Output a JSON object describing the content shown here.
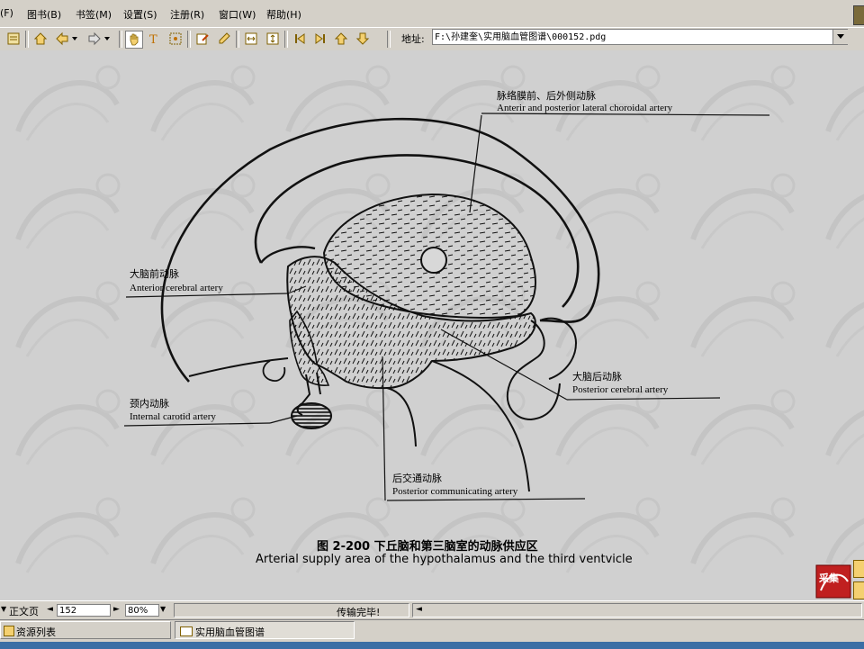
{
  "menu": {
    "items": [
      "(F)",
      "图书(B)",
      "书签(M)",
      "设置(S)",
      "注册(R)",
      "窗口(W)",
      "帮助(H)"
    ]
  },
  "toolbar": {
    "address_label": "地址:",
    "address_value": "F:\\孙建奎\\实用脑血管图谱\\000152.pdg"
  },
  "figure": {
    "labels": {
      "choroidal_cn": "脉络膜前、后外侧动脉",
      "choroidal_en": "Anterir and posterior lateral choroidal artery",
      "aca_cn": "大脑前动脉",
      "aca_en": "Anterior cerebral artery",
      "ica_cn": "颈内动脉",
      "ica_en": "Internal carotid artery",
      "pca_cn": "大脑后动脉",
      "pca_en": "Posterior cerebral artery",
      "pcom_cn": "后交通动脉",
      "pcom_en": "Posterior communicating artery"
    },
    "caption_cn": "图 2-200   下丘脑和第三脑室的动脉供应区",
    "caption_en": "Arterial supply area of the hypothalamus and the third ventvicle"
  },
  "status": {
    "page_type": "正文页",
    "page_number": "152",
    "zoom": "80%",
    "message": "传输完毕!"
  },
  "taskbar": {
    "resources": "资源列表",
    "book_tab": "实用脑血管图谱"
  },
  "corner_logo": "采集"
}
